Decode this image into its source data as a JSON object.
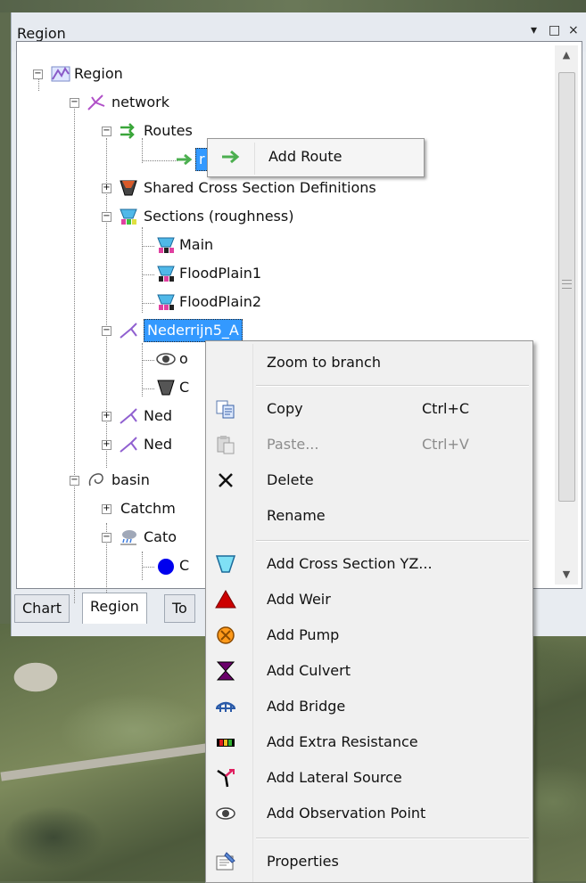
{
  "panel": {
    "title": "Region",
    "buttons": {
      "pin": "▾",
      "restore": "□",
      "close": "×"
    }
  },
  "tree": {
    "nodes": [
      {
        "label": "Region",
        "icon": "region-icon",
        "expander": "−"
      },
      {
        "label": "network",
        "icon": "network-icon",
        "expander": "−"
      },
      {
        "label": "Routes",
        "icon": "routes-icon",
        "expander": "−"
      },
      {
        "label": "r",
        "icon": "route-arrow-icon",
        "selected": true
      },
      {
        "label": "Shared Cross Section Definitions",
        "icon": "cross-section-icon",
        "expander": "+"
      },
      {
        "label": "Sections (roughness)",
        "icon": "sections-icon",
        "expander": "−"
      },
      {
        "label": "Main",
        "icon": "section-icon"
      },
      {
        "label": "FloodPlain1",
        "icon": "section-icon"
      },
      {
        "label": "FloodPlain2",
        "icon": "section-icon"
      },
      {
        "label": "Nederrijn5_A",
        "icon": "branch-icon",
        "expander": "−",
        "selected": true
      },
      {
        "label": "o",
        "icon": "observation-icon"
      },
      {
        "label": "C",
        "icon": "cross-section-icon"
      },
      {
        "label": "Ned",
        "icon": "branch-icon",
        "expander": "+"
      },
      {
        "label": "Ned",
        "icon": "branch-icon",
        "expander": "+"
      },
      {
        "label": "basin",
        "icon": "basin-icon",
        "expander": "−"
      },
      {
        "label": "Catchm",
        "icon": "",
        "expander": "+"
      },
      {
        "label": "Cato",
        "icon": "catchment-icon",
        "expander": "−"
      },
      {
        "label": "C",
        "icon": "circle-icon"
      }
    ]
  },
  "tabs": [
    {
      "label": "Chart"
    },
    {
      "label": "Region",
      "active": true
    },
    {
      "label": "To"
    }
  ],
  "route_menu": {
    "add_route": "Add Route"
  },
  "context_menu": {
    "items": [
      {
        "label": "Zoom to branch",
        "icon": ""
      },
      {
        "label": "Copy",
        "shortcut": "Ctrl+C",
        "icon": "copy-icon"
      },
      {
        "label": "Paste...",
        "shortcut": "Ctrl+V",
        "icon": "paste-icon",
        "disabled": true
      },
      {
        "label": "Delete",
        "icon": "delete-icon"
      },
      {
        "label": "Rename",
        "icon": ""
      },
      {
        "label": "Add Cross Section YZ...",
        "icon": "cross-section-icon"
      },
      {
        "label": "Add Weir",
        "icon": "weir-icon"
      },
      {
        "label": "Add Pump",
        "icon": "pump-icon"
      },
      {
        "label": "Add Culvert",
        "icon": "culvert-icon"
      },
      {
        "label": "Add Bridge",
        "icon": "bridge-icon"
      },
      {
        "label": "Add Extra Resistance",
        "icon": "extra-resistance-icon"
      },
      {
        "label": "Add Lateral Source",
        "icon": "lateral-source-icon"
      },
      {
        "label": "Add Observation Point",
        "icon": "observation-icon"
      },
      {
        "label": "Properties",
        "icon": "properties-icon"
      }
    ]
  },
  "colors": {
    "selection": "#3399ff",
    "weir": "#cc0000",
    "pump": "#ff8c00",
    "culvert": "#6a006a",
    "bridge": "#2a5aa8",
    "route_arrow": "#4caf50"
  }
}
